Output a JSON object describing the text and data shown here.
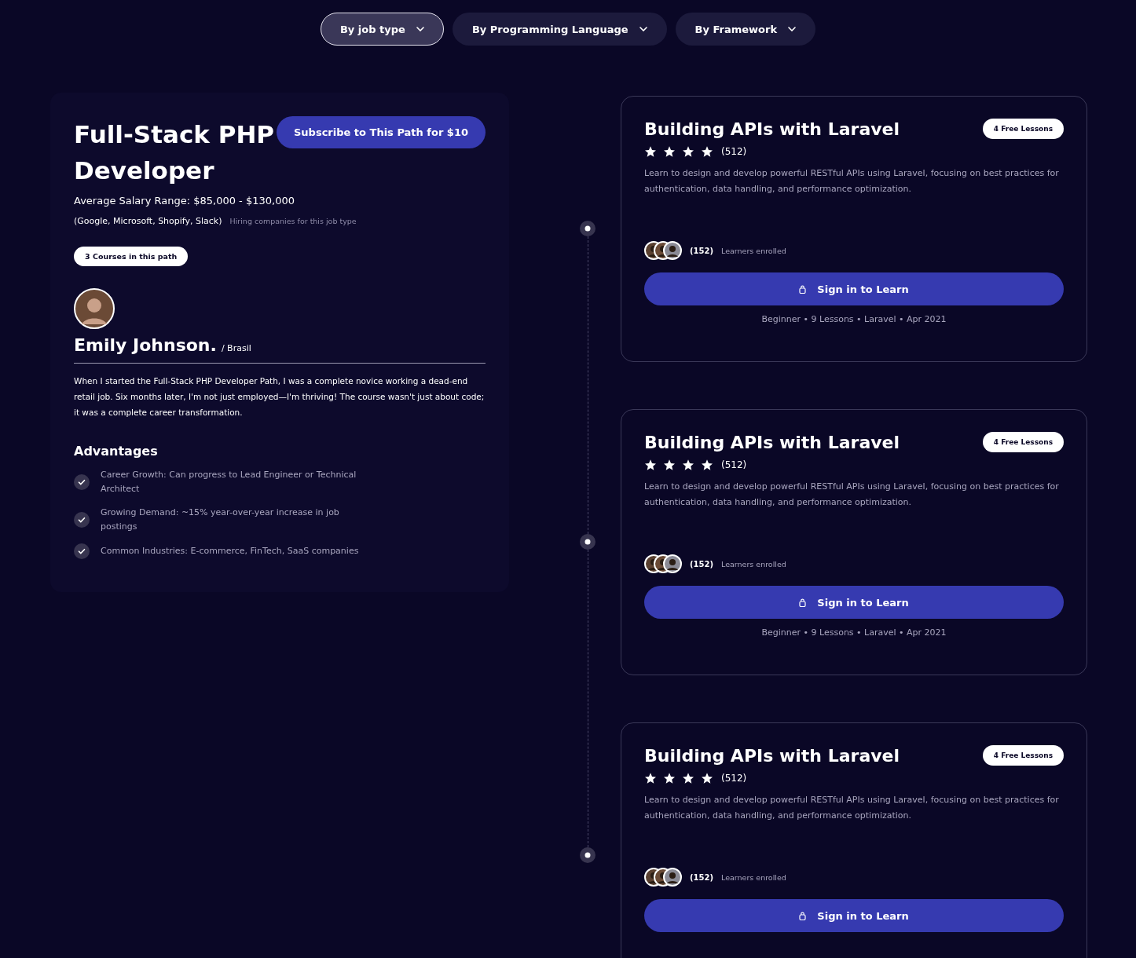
{
  "filters": [
    {
      "label": "By job type",
      "selected": true
    },
    {
      "label": "By Programming Language",
      "selected": false
    },
    {
      "label": "By Framework",
      "selected": false
    }
  ],
  "path": {
    "title": "Full-Stack PHP Developer",
    "subscribe_button": "Subscribe to This Path for $10",
    "salary": "Average Salary Range: $85,000 - $130,000",
    "companies": "(Google, Microsoft, Shopify, Slack)",
    "companies_note": "Hiring companies  for this job type",
    "courses_badge": "3 Courses in this path",
    "testimonial": {
      "name": "Emily Johnson.",
      "location": "/ Brasil",
      "quote": "When I started the Full-Stack PHP Developer Path, I was a complete novice working a dead-end retail job. Six months later, I'm not just employed—I'm thriving! The course wasn't just about code; it was a complete career transformation."
    },
    "advantages_title": "Advantages",
    "advantages": [
      "Career Growth: Can progress to Lead Engineer or Technical Architect",
      "Growing Demand: ~15% year-over-year increase in job postings",
      "Common Industries: E-commerce, FinTech, SaaS companies"
    ]
  },
  "courses": [
    {
      "title": "Building APIs with Laravel",
      "badge": "4 Free Lessons",
      "stars": 4,
      "rating_count": "(512)",
      "description": "Learn to design and develop powerful RESTful APIs using Laravel, focusing on best practices for authentication, data handling, and performance optimization.",
      "learners_count": "(152)",
      "learners_label": "Learners enrolled",
      "button": "Sign in to Learn",
      "meta": "Beginner • 9 Lessons • Laravel • Apr 2021"
    },
    {
      "title": "Building APIs with Laravel",
      "badge": "4 Free Lessons",
      "stars": 4,
      "rating_count": "(512)",
      "description": "Learn to design and develop powerful RESTful APIs using Laravel, focusing on best practices for authentication, data handling, and performance optimization.",
      "learners_count": "(152)",
      "learners_label": "Learners enrolled",
      "button": "Sign in to Learn",
      "meta": "Beginner • 9 Lessons • Laravel • Apr 2021"
    },
    {
      "title": "Building APIs with Laravel",
      "badge": "4 Free Lessons",
      "stars": 4,
      "rating_count": "(512)",
      "description": "Learn to design and develop powerful RESTful APIs using Laravel, focusing on best practices for authentication, data handling, and performance optimization.",
      "learners_count": "(152)",
      "learners_label": "Learners enrolled",
      "button": "Sign in to Learn"
    }
  ]
}
